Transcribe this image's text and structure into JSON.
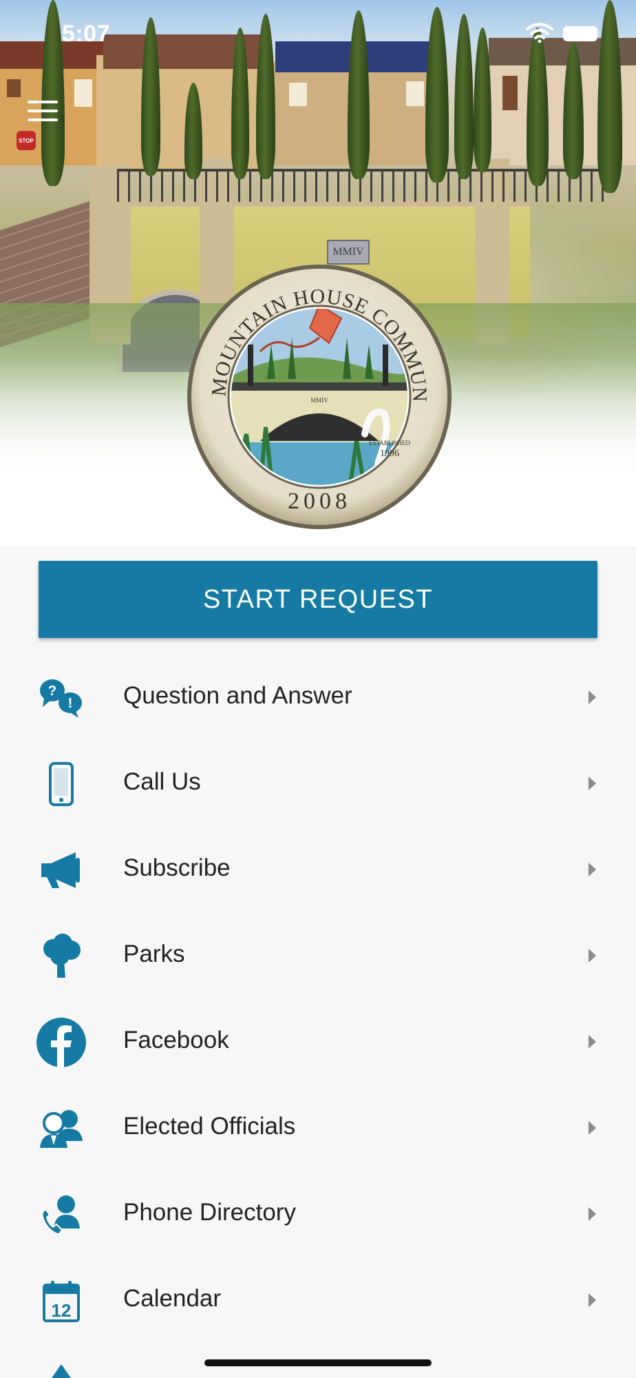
{
  "status": {
    "time": "5:07"
  },
  "seal": {
    "arc_text": "MOUNTAIN HOUSE COMMUNITY SERVICES DISTRICT",
    "year": "2008",
    "established": "ESTABLISHED",
    "established_year": "1996",
    "bridge_plaque": "MMIV"
  },
  "hero": {
    "plaque": "MMIV",
    "sign": "STOP"
  },
  "primary_action": {
    "label": "START REQUEST"
  },
  "menu": {
    "items": [
      {
        "label": "Question and Answer",
        "icon": "question-answer-icon"
      },
      {
        "label": "Call Us",
        "icon": "phone-icon"
      },
      {
        "label": "Subscribe",
        "icon": "megaphone-icon"
      },
      {
        "label": "Parks",
        "icon": "tree-icon"
      },
      {
        "label": "Facebook",
        "icon": "facebook-icon"
      },
      {
        "label": "Elected Officials",
        "icon": "officials-icon"
      },
      {
        "label": "Phone Directory",
        "icon": "phone-directory-icon"
      },
      {
        "label": "Calendar",
        "icon": "calendar-icon"
      }
    ]
  },
  "theme": {
    "accent": "#157ba4",
    "text": "#222222",
    "background": "#f7f7f7"
  }
}
